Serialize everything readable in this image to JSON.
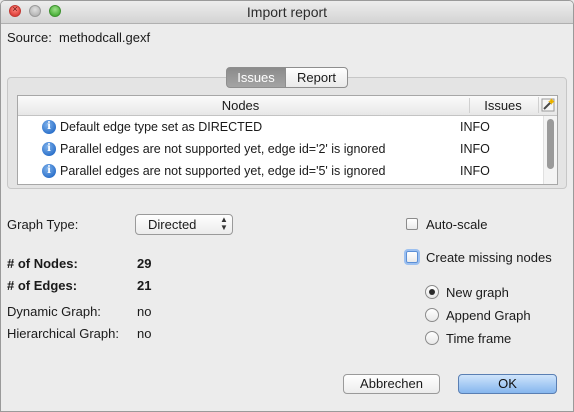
{
  "window": {
    "title": "Import report"
  },
  "source": {
    "label": "Source:",
    "value": "methodcall.gexf"
  },
  "tabs": [
    {
      "label": "Issues",
      "selected": true
    },
    {
      "label": "Report",
      "selected": false
    }
  ],
  "issues_table": {
    "columns": [
      "Nodes",
      "Issues"
    ],
    "corner_icon": "wand-icon",
    "rows": [
      {
        "icon": "info-icon",
        "message": "Default edge type set as DIRECTED",
        "level": "INFO"
      },
      {
        "icon": "info-icon",
        "message": "Parallel edges are not supported yet, edge id='2' is ignored",
        "level": "INFO"
      },
      {
        "icon": "info-icon",
        "message": "Parallel edges are not supported yet, edge id='5' is ignored",
        "level": "INFO"
      }
    ]
  },
  "graph_type": {
    "label": "Graph Type:",
    "selected": "Directed"
  },
  "stats": {
    "nodes_label": "# of Nodes:",
    "nodes_value": "29",
    "edges_label": "# of Edges:",
    "edges_value": "21",
    "dynamic_label": "Dynamic Graph:",
    "dynamic_value": "no",
    "hierarchical_label": "Hierarchical Graph:",
    "hierarchical_value": "no"
  },
  "options": {
    "auto_scale": {
      "label": "Auto-scale",
      "checked": false
    },
    "create_missing_nodes": {
      "label": "Create missing nodes",
      "checked": false
    }
  },
  "merge_mode": {
    "options": [
      {
        "label": "New graph",
        "selected": true
      },
      {
        "label": "Append Graph",
        "selected": false
      },
      {
        "label": "Time frame",
        "selected": false
      }
    ]
  },
  "buttons": {
    "cancel": "Abbrechen",
    "ok": "OK"
  },
  "colors": {
    "window_bg": "#ececec",
    "selected_tab": "#8b8b8b",
    "info_icon": "#2a6fc9",
    "default_button": "#86b6ee"
  }
}
